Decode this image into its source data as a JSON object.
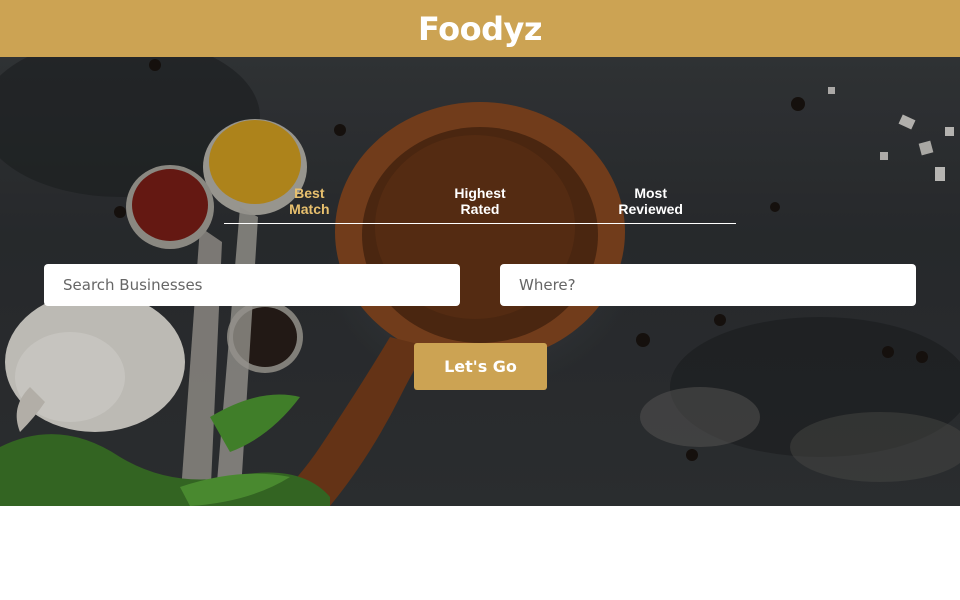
{
  "header": {
    "logo_text": "Foodyz",
    "background_color": "#cca353"
  },
  "sort_tabs": [
    {
      "label": "Best\nMatch",
      "line1": "Best",
      "line2": "Match",
      "active": true
    },
    {
      "label": "Highest\nRated",
      "line1": "Highest",
      "line2": "Rated",
      "active": false
    },
    {
      "label": "Most\nReviewed",
      "line1": "Most",
      "line2": "Reviewed",
      "active": false
    }
  ],
  "search": {
    "business_placeholder": "Search Businesses",
    "location_placeholder": "Where?"
  },
  "actions": {
    "go_label": "Let's Go"
  },
  "colors": {
    "accent": "#cca353",
    "active_tab": "#e8c06e"
  }
}
